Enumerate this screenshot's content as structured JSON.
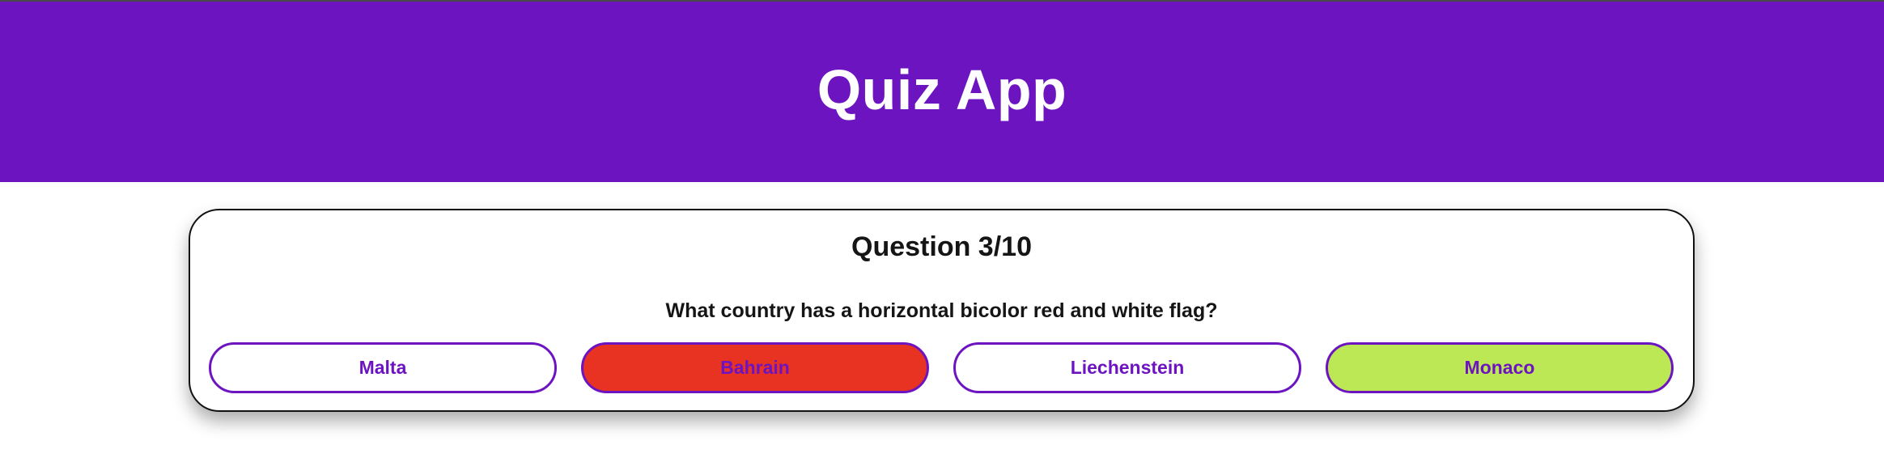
{
  "app": {
    "title": "Quiz App"
  },
  "quiz": {
    "question_counter": "Question 3/10",
    "question_text": "What country has a horizontal bicolor red and white flag?",
    "answers": [
      {
        "label": "Malta",
        "state": "default"
      },
      {
        "label": "Bahrain",
        "state": "wrong"
      },
      {
        "label": "Liechenstein",
        "state": "default"
      },
      {
        "label": "Monaco",
        "state": "correct"
      }
    ]
  },
  "colors": {
    "header_bg": "#6d14c1",
    "accent": "#6d14c1",
    "wrong": "#e83323",
    "correct": "#bde856"
  }
}
